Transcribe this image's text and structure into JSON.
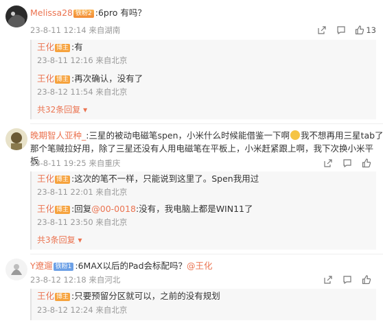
{
  "comments": [
    {
      "user": "Melissa28",
      "badge": "铁粉2",
      "text": ":6pro 有吗？",
      "time": "23-8-11 12:14 来自湖南",
      "likes": "13",
      "replies": [
        {
          "user": "王化",
          "badge": "博主",
          "text": ":有",
          "time": "23-8-11 12:16 来自北京"
        },
        {
          "user": "王化",
          "badge": "博主",
          "text": ":再次确认，没有了",
          "time": "23-8-12 11:54 来自北京"
        }
      ],
      "more": "共32条回复"
    },
    {
      "user": "晚期智人亚种_",
      "text_a": ":三星的被动电磁笔spen，小米什么时候能借鉴一下啊",
      "text_b": "我不想再用三星tab了，",
      "text_c": "那个笔贼拉好用，除了三星还没有人用电磁笔在平板上，小米赶紧跟上啊，我下次换小米平板",
      "time": "23-8-11 19:25 来自重庆",
      "replies": [
        {
          "user": "王化",
          "badge": "博主",
          "text": ":这次的笔不一样，只能说到这里了。Spen我用过",
          "time": "23-8-11 22:01 来自北京"
        },
        {
          "user": "王化",
          "badge": "博主",
          "text_pre": ":回复",
          "mention": "@00-0018",
          "text_post": ":没有，我电脑上都是WIN11了",
          "time": "23-8-11 23:50 来自北京"
        }
      ],
      "more": "共3条回复"
    },
    {
      "user": "Y遼遛",
      "badge": "铁粉1",
      "text_pre": ":6MAX以后的Pad会标配吗？",
      "mention": "@王化",
      "time": "23-8-12 12:18 来自河北",
      "replies": [
        {
          "user": "王化",
          "badge": "博主",
          "text": ":只要预留分区就可以，之前的没有规划",
          "time": "23-8-12 12:24 来自北京"
        }
      ]
    }
  ],
  "colors": {
    "accent": "#eb7350",
    "meta": "#999999"
  }
}
